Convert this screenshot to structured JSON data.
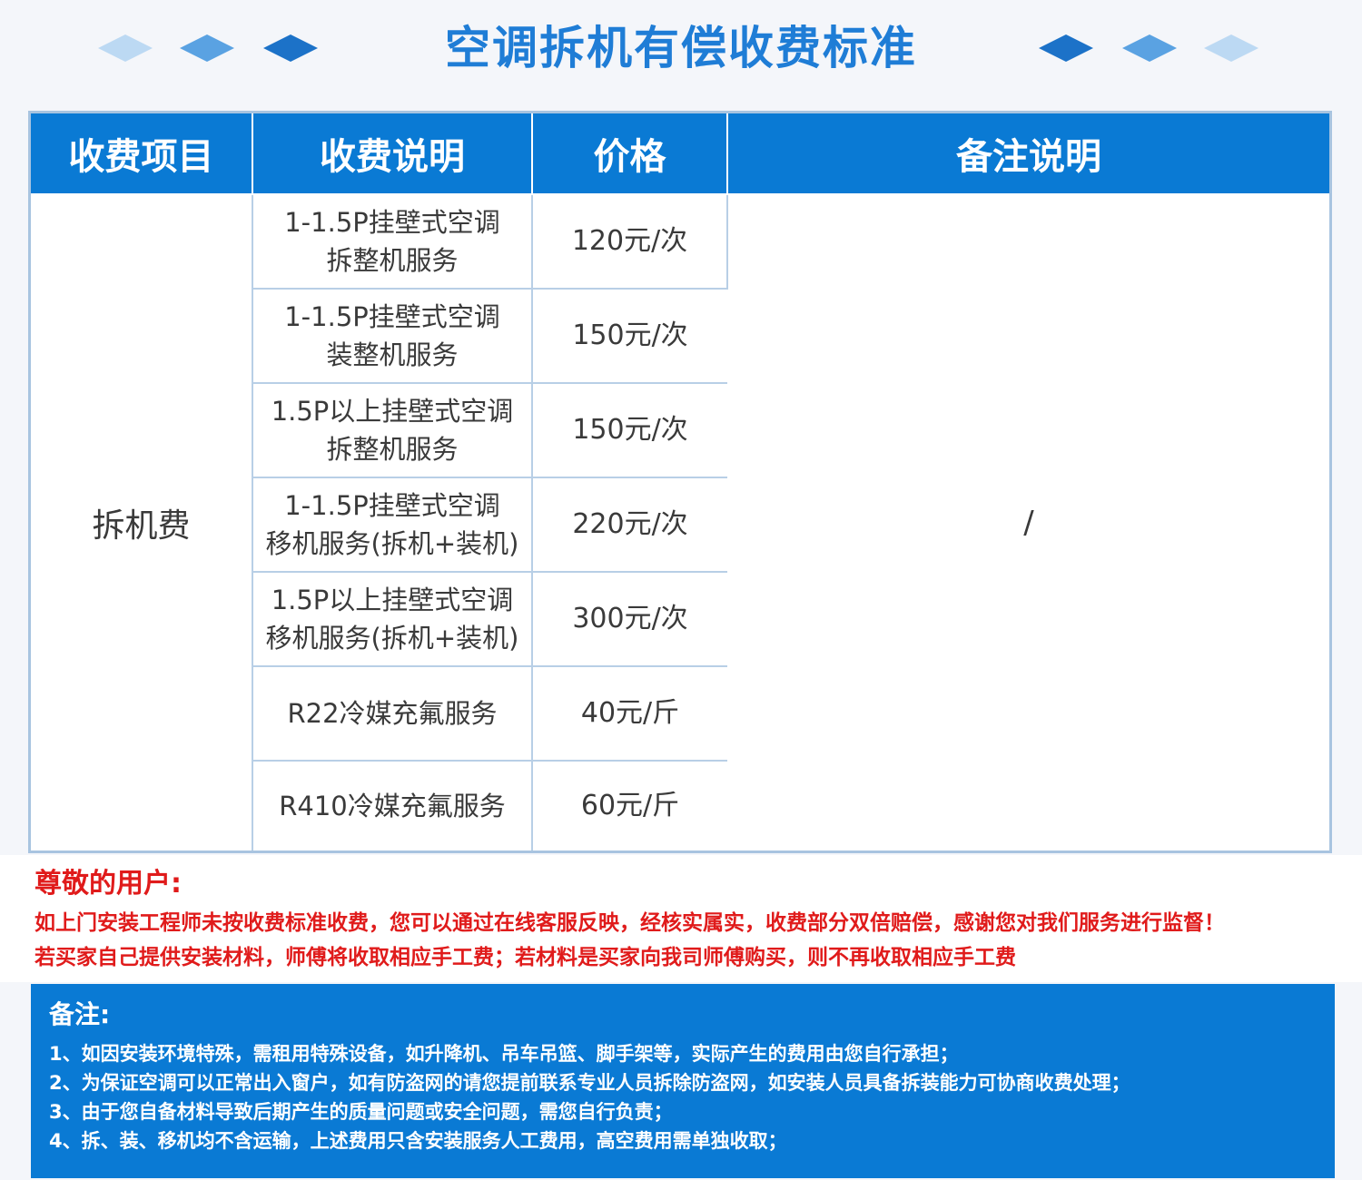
{
  "header": {
    "title": "空调拆机有偿收费标准",
    "accent_color": "#1f7dd6",
    "decoration_icon": "diamond-icon"
  },
  "table": {
    "headers": [
      "收费项目",
      "收费说明",
      "价格",
      "备注说明"
    ],
    "category": "拆机费",
    "note": "/",
    "rows": [
      {
        "desc": "1-1.5P挂壁式空调\n拆整机服务",
        "price": "120元/次"
      },
      {
        "desc": "1-1.5P挂壁式空调\n装整机服务",
        "price": "150元/次"
      },
      {
        "desc": "1.5P以上挂壁式空调\n拆整机服务",
        "price": "150元/次"
      },
      {
        "desc": "1-1.5P挂壁式空调\n移机服务(拆机+装机)",
        "price": "220元/次"
      },
      {
        "desc": "1.5P以上挂壁式空调\n移机服务(拆机+装机)",
        "price": "300元/次"
      },
      {
        "desc": "R22冷媒充氟服务",
        "price": "40元/斤"
      },
      {
        "desc": "R410冷媒充氟服务",
        "price": "60元/斤"
      }
    ],
    "header_color": "#0a7ad4"
  },
  "notice": {
    "title": "尊敬的用户:",
    "line1": "如上门安装工程师未按收费标准收费，您可以通过在线客服反映，经核实属实，收费部分双倍赔偿，感谢您对我们服务进行监督！",
    "line2": "若买家自己提供安装材料，师傅将收取相应手工费；若材料是买家向我司师傅购买，则不再收取相应手工费",
    "color": "#e01b1b"
  },
  "remarks": {
    "title": "备注:",
    "items": [
      "1、如因安装环境特殊，需租用特殊设备，如升降机、吊车吊篮、脚手架等，实际产生的费用由您自行承担；",
      "2、为保证空调可以正常出入窗户，如有防盗网的请您提前联系专业人员拆除防盗网，如安装人员具备拆装能力可协商收费处理；",
      "3、由于您自备材料导致后期产生的质量问题或安全问题，需您自行负责；",
      "4、拆、装、移机均不含运输，上述费用只含安装服务人工费用，高空费用需单独收取；"
    ],
    "background": "#0a7ad4"
  }
}
